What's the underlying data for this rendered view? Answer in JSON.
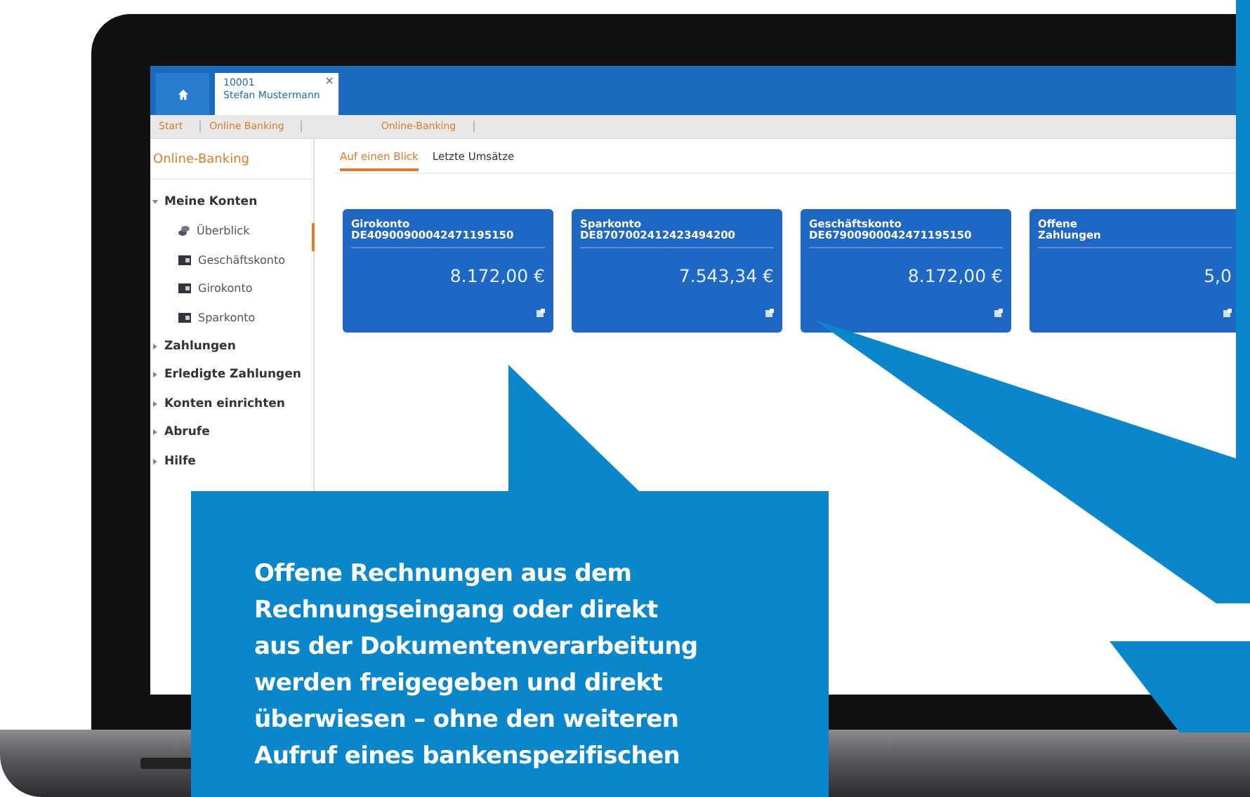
{
  "session_tabs": [
    {
      "number": "10001",
      "name": "Stefan Mustermann",
      "selected": true,
      "close": "×"
    }
  ],
  "breadcrumb": [
    "Start",
    "Online Banking",
    "Online-Banking"
  ],
  "sidebar": {
    "title": "Online-Banking",
    "items": [
      {
        "label": "Meine Konten",
        "expanded": true,
        "children": [
          {
            "label": "Überblick",
            "kind": "overview"
          },
          {
            "label": "Geschäftskonto",
            "kind": "account"
          },
          {
            "label": "Girokonto",
            "kind": "account"
          },
          {
            "label": "Sparkonto",
            "kind": "account"
          }
        ]
      },
      {
        "label": "Zahlungen",
        "expanded": false
      },
      {
        "label": "Erledigte Zahlungen",
        "expanded": false
      },
      {
        "label": "Konten einrichten",
        "expanded": false
      },
      {
        "label": "Abrufe",
        "expanded": false
      },
      {
        "label": "Hilfe",
        "expanded": false
      }
    ]
  },
  "content_tabs": [
    {
      "label": "Auf einen Blick",
      "selected": true
    },
    {
      "label": "Letzte Umsätze",
      "selected": false
    }
  ],
  "tiles": [
    {
      "title": "Girokonto",
      "iban": "DE40900900042471195150",
      "amount": "8.172,00 €"
    },
    {
      "title": "Sparkonto",
      "iban": "DE8707002412423494200",
      "amount": "7.543,34 €"
    },
    {
      "title": "Geschäftskonto",
      "iban": "DE67900900042471195150",
      "amount": "8.172,00 €"
    },
    {
      "title": "Offene\nZahlungen",
      "amount": "5,0"
    }
  ],
  "callout": {
    "text": "Offene Rechnungen aus dem\nRechnungseingang oder direkt\naus der Dokumentenverarbeitung\nwerden freigegeben und direkt\nüberwiesen – ohne den weiteren\nAufruf eines bankenspezifischen"
  }
}
